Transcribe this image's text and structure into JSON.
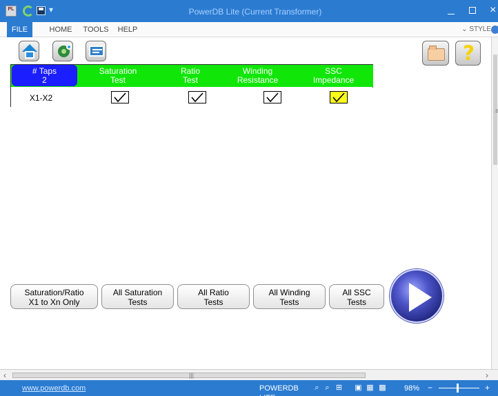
{
  "window": {
    "title": "PowerDB Lite (Current Transformer)"
  },
  "menu": {
    "items": [
      "FILE",
      "HOME",
      "TOOLS",
      "HELP"
    ],
    "style_label": "STYLE"
  },
  "table": {
    "taps_header": "# Taps",
    "taps_value": "2",
    "headers": [
      {
        "line1": "Saturation",
        "line2": "Test"
      },
      {
        "line1": "Ratio",
        "line2": "Test"
      },
      {
        "line1": "Winding",
        "line2": "Resistance"
      },
      {
        "line1": "SSC",
        "line2": "Impedance"
      }
    ],
    "row_label": "X1-X2",
    "checked": [
      true,
      true,
      true,
      true
    ],
    "highlighted": "SSC Impedance"
  },
  "actions": [
    {
      "line1": "Saturation/Ratio",
      "line2": "X1 to Xn Only"
    },
    {
      "line1": "All Saturation",
      "line2": "Tests"
    },
    {
      "line1": "All Ratio",
      "line2": "Tests"
    },
    {
      "line1": "All Winding",
      "line2": "Tests"
    },
    {
      "line1": "All SSC",
      "line2": "Tests"
    }
  ],
  "status": {
    "link": "www.powerdb.com",
    "app": "POWERDB LITE",
    "zoom": "98%"
  },
  "icons": {
    "home": "home-icon",
    "settings": "settings-icon",
    "cards": "cards-icon",
    "folder": "folder-icon",
    "help": "help-icon",
    "play": "play-icon"
  },
  "colors": {
    "title_bar": "#2b7bd1",
    "header_green": "#11e609",
    "taps_blue": "#1b1eff",
    "highlight_yellow": "#ffff1a",
    "play_purple": "#4d55c9"
  }
}
